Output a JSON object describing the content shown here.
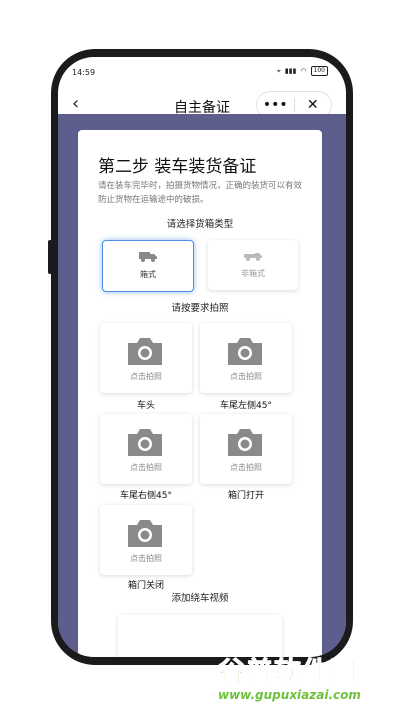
{
  "status": {
    "time": "14:59",
    "battery": "100"
  },
  "nav": {
    "title": "自主备证",
    "more_icon": "•••",
    "close_icon": "✕"
  },
  "form": {
    "step_title": "第二步 装车装货备证",
    "description": "请在装车完毕时，拍摄货物情况，正确的装货可以有效防止货物在运输途中的破损。",
    "box_type_label": "请选择货箱类型",
    "box_types": [
      {
        "label": "箱式",
        "selected": true
      },
      {
        "label": "非箱式",
        "selected": false
      }
    ],
    "photo_section_label": "请按要求拍照",
    "photos": [
      {
        "hint": "点击拍照",
        "label": "车头"
      },
      {
        "hint": "点击拍照",
        "label": "车尾左侧45°"
      },
      {
        "hint": "点击拍照",
        "label": "车尾右侧45°"
      },
      {
        "hint": "点击拍照",
        "label": "箱门打开"
      },
      {
        "hint": "点击拍照",
        "label": "箱门关闭"
      }
    ],
    "video_section_label": "添加绕车视频"
  },
  "watermark": {
    "title": "谷普软件园",
    "url": "www.gupuxiazai.com"
  },
  "colors": {
    "background": "#5d5d8e",
    "accent": "#4a90e2",
    "watermark": "#6dc23c"
  }
}
